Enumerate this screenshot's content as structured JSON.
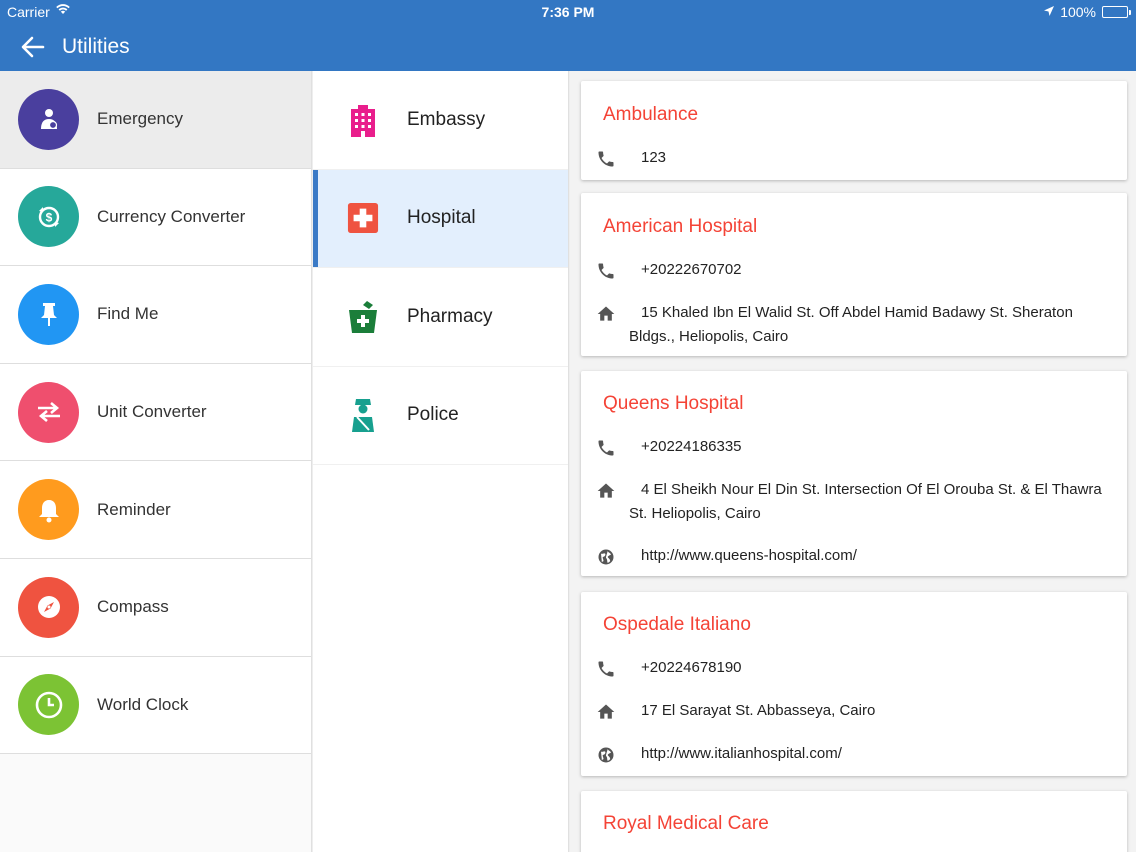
{
  "status_bar": {
    "carrier": "Carrier",
    "time": "7:36 PM",
    "battery": "100%"
  },
  "header": {
    "title": "Utilities"
  },
  "utilities": [
    {
      "label": "Emergency",
      "color": "#4a3f9e",
      "icon": "emergency-icon"
    },
    {
      "label": "Currency Converter",
      "color": "#26a89a",
      "icon": "currency-icon"
    },
    {
      "label": "Find Me",
      "color": "#2196f3",
      "icon": "pin-icon"
    },
    {
      "label": "Unit Converter",
      "color": "#ef4f6e",
      "icon": "swap-icon"
    },
    {
      "label": "Reminder",
      "color": "#ff9b1e",
      "icon": "bell-icon"
    },
    {
      "label": "Compass",
      "color": "#ef5340",
      "icon": "compass-icon"
    },
    {
      "label": "World Clock",
      "color": "#7cc334",
      "icon": "clock-icon"
    }
  ],
  "categories": [
    {
      "label": "Embassy",
      "icon": "building-icon",
      "color": "#e91e8c"
    },
    {
      "label": "Hospital",
      "icon": "hospital-icon",
      "color": "#ef5340"
    },
    {
      "label": "Pharmacy",
      "icon": "pharmacy-icon",
      "color": "#1b7e3a"
    },
    {
      "label": "Police",
      "icon": "police-icon",
      "color": "#17a08f"
    }
  ],
  "contacts": [
    {
      "name": "Ambulance",
      "phone": "123"
    },
    {
      "name": "American Hospital",
      "phone": "+20222670702",
      "address": "15 Khaled Ibn El Walid St. Off Abdel Hamid Badawy St. Sheraton Bldgs., Heliopolis, Cairo"
    },
    {
      "name": "Queens Hospital",
      "phone": "+20224186335",
      "address": "4 El Sheikh Nour El Din St. Intersection Of El Orouba St. & El Thawra St. Heliopolis, Cairo",
      "website": "http://www.queens-hospital.com/"
    },
    {
      "name": "Ospedale Italiano",
      "phone": "+20224678190",
      "address": "17 El Sarayat St. Abbasseya, Cairo",
      "website": "http://www.italianhospital.com/"
    },
    {
      "name": "Royal Medical Care"
    }
  ]
}
